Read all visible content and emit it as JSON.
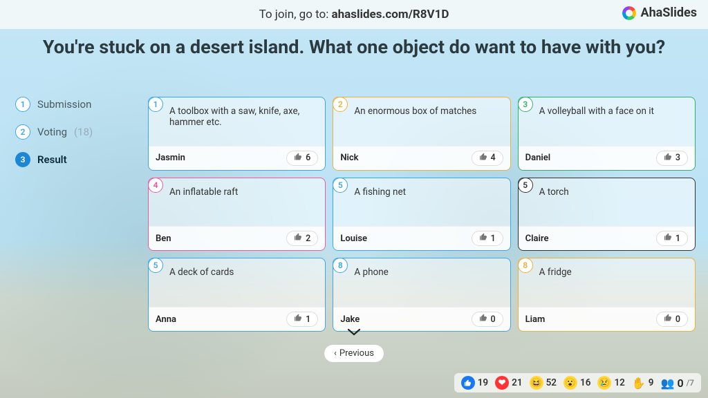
{
  "topbar": {
    "join_prefix": "To join, go to: ",
    "join_url": "ahaslides.com/R8V1D"
  },
  "brand": {
    "name": "AhaSlides"
  },
  "question": "You're stuck on a desert island. What one object do want to have with you?",
  "steps": [
    {
      "num": "1",
      "label": "Submission",
      "count": ""
    },
    {
      "num": "2",
      "label": "Voting",
      "count": "(18)"
    },
    {
      "num": "3",
      "label": "Result",
      "count": ""
    }
  ],
  "active_step": 2,
  "card_colors": [
    "#3aa8e8",
    "#e8b33a",
    "#2fb36a",
    "#e85aa0",
    "#3aa8e8",
    "#333333",
    "#3aa8e8",
    "#3aa8e8",
    "#e8b33a"
  ],
  "cards": [
    {
      "rank": "1",
      "answer": "A toolbox with a saw, knife, axe, hammer etc.",
      "author": "Jasmin",
      "votes": "6"
    },
    {
      "rank": "2",
      "answer": "An enormous box of matches",
      "author": "Nick",
      "votes": "4"
    },
    {
      "rank": "3",
      "answer": "A volleyball with a face on it",
      "author": "Daniel",
      "votes": "3"
    },
    {
      "rank": "4",
      "answer": "An inflatable raft",
      "author": "Ben",
      "votes": "2"
    },
    {
      "rank": "5",
      "answer": "A fishing net",
      "author": "Louise",
      "votes": "1"
    },
    {
      "rank": "5",
      "answer": "A torch",
      "author": "Claire",
      "votes": "1"
    },
    {
      "rank": "5",
      "answer": "A deck of cards",
      "author": "Anna",
      "votes": "1"
    },
    {
      "rank": "8",
      "answer": "A phone",
      "author": "Jake",
      "votes": "0"
    },
    {
      "rank": "8",
      "answer": "A fridge",
      "author": "Liam",
      "votes": "0"
    }
  ],
  "prev_label": "Previous",
  "reactions": {
    "like": "19",
    "love": "21",
    "haha": "52",
    "wow": "16",
    "sad": "12",
    "hand": "9",
    "people_here": "0",
    "people_total": "/7"
  }
}
